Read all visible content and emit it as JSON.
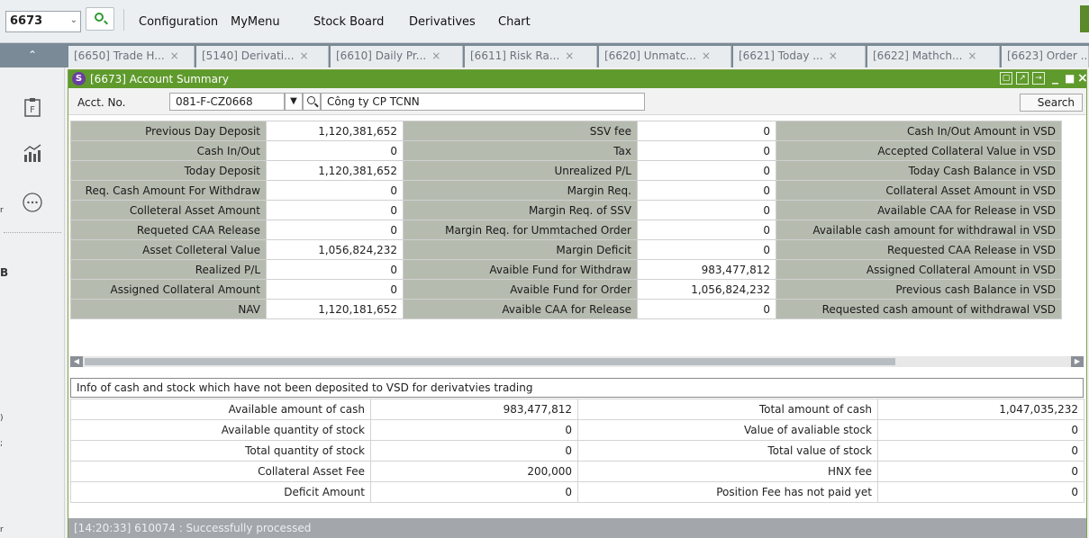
{
  "toolbar": {
    "screen_code": "6673",
    "menus": [
      "Configuration",
      "MyMenu",
      "Stock Board",
      "Derivatives",
      "Chart"
    ]
  },
  "tabs": [
    "[6650] Trade H...",
    "[5140] Derivati...",
    "[6610] Daily Pr...",
    "[6611] Risk Ra...",
    "[6620] Unmatc...",
    "[6621] Today ...",
    "[6622] Mathch...",
    "[6623] Order ..."
  ],
  "rail": {
    "letters": [
      "r",
      "B",
      ")",
      ";",
      "r"
    ]
  },
  "window": {
    "title": "[6673] Account Summary"
  },
  "account": {
    "label": "Acct. No.",
    "number": "081-F-CZ0668",
    "name": "Công ty CP TCNN",
    "search_label": "Search"
  },
  "summary_rows": [
    {
      "l1": "Previous Day Deposit",
      "v1": "1,120,381,652",
      "l2": "SSV fee",
      "v2": "0",
      "l3": "Cash In/Out Amount in VSD"
    },
    {
      "l1": "Cash In/Out",
      "v1": "0",
      "l2": "Tax",
      "v2": "0",
      "l3": "Accepted Collateral Value in VSD"
    },
    {
      "l1": "Today Deposit",
      "v1": "1,120,381,652",
      "l2": "Unrealized P/L",
      "v2": "0",
      "l3": "Today Cash Balance in VSD"
    },
    {
      "l1": "Req. Cash Amount For Withdraw",
      "v1": "0",
      "l2": "Margin Req.",
      "v2": "0",
      "l3": "Collateral Asset Amount in VSD"
    },
    {
      "l1": "Colleteral Asset Amount",
      "v1": "0",
      "l2": "Margin Req. of SSV",
      "v2": "0",
      "l3": "Available CAA for Release in VSD"
    },
    {
      "l1": "Requeted CAA Release",
      "v1": "0",
      "l2": "Margin Req. for Ummtached Order",
      "v2": "0",
      "l3": "Available cash amount for withdrawal in VSD"
    },
    {
      "l1": "Asset Colleteral Value",
      "v1": "1,056,824,232",
      "l2": "Margin Deficit",
      "v2": "0",
      "l3": "Requested CAA Release in VSD"
    },
    {
      "l1": "Realized P/L",
      "v1": "0",
      "l2": "Avaible Fund for Withdraw",
      "v2": "983,477,812",
      "l3": "Assigned Collateral Amount in VSD"
    },
    {
      "l1": "Assigned Collateral Amount",
      "v1": "0",
      "l2": "Avaible Fund for Order",
      "v2": "1,056,824,232",
      "l3": "Previous cash Balance in VSD"
    },
    {
      "l1": "NAV",
      "v1": "1,120,181,652",
      "l2": "Avaible CAA for Release",
      "v2": "0",
      "l3": "Requested cash amount of withdrawal VSD"
    }
  ],
  "info": {
    "title": "Info of cash and stock which have not been deposited to VSD for derivatvies trading",
    "rows": [
      {
        "l1": "Available amount of cash",
        "v1": "983,477,812",
        "l2": "Total amount of cash",
        "v2": "1,047,035,232"
      },
      {
        "l1": "Available quantity of stock",
        "v1": "0",
        "l2": "Value of avaliable stock",
        "v2": "0"
      },
      {
        "l1": "Total quantity of stock",
        "v1": "0",
        "l2": "Total value of stock",
        "v2": "0"
      },
      {
        "l1": "Collateral Asset Fee",
        "v1": "200,000",
        "l2": "HNX fee",
        "v2": "0"
      },
      {
        "l1": "Deficit Amount",
        "v1": "0",
        "l2": "Position Fee has not paid yet",
        "v2": "0"
      }
    ]
  },
  "status": "[14:20:33] 610074 : Successfully processed"
}
